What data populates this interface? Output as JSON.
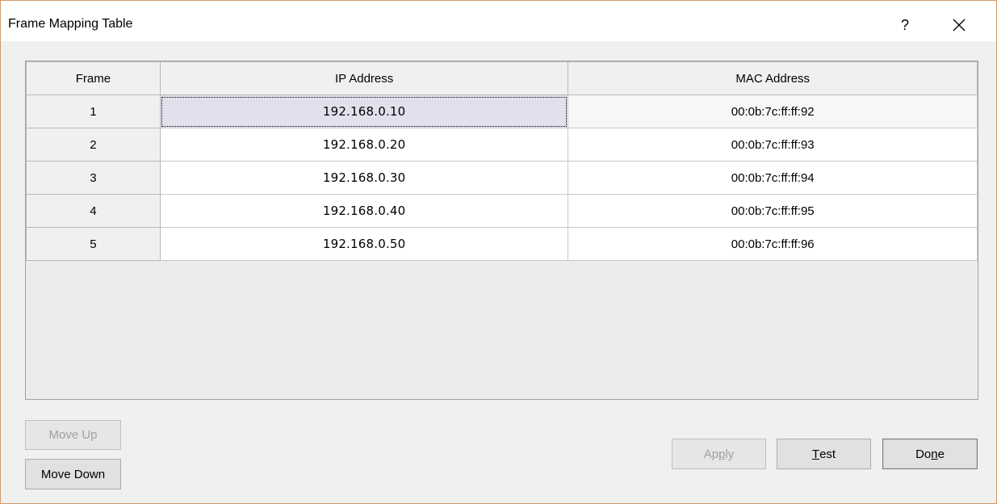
{
  "window": {
    "title": "Frame Mapping Table",
    "help_label": "?",
    "close_icon": "close-icon"
  },
  "table": {
    "columns": [
      "Frame",
      "IP Address",
      "MAC Address"
    ],
    "rows": [
      {
        "frame": "1",
        "ip": "192.168.0.10",
        "mac": "00:0b:7c:ff:ff:92"
      },
      {
        "frame": "2",
        "ip": "192.168.0.20",
        "mac": "00:0b:7c:ff:ff:93"
      },
      {
        "frame": "3",
        "ip": "192.168.0.30",
        "mac": "00:0b:7c:ff:ff:94"
      },
      {
        "frame": "4",
        "ip": "192.168.0.40",
        "mac": "00:0b:7c:ff:ff:95"
      },
      {
        "frame": "5",
        "ip": "192.168.0.50",
        "mac": "00:0b:7c:ff:ff:96"
      }
    ],
    "selected_cell": "1 / IP Address"
  },
  "buttons": {
    "move_up": "Move Up",
    "move_down": "Move Down",
    "apply_pre": "Ap",
    "apply_mn": "p",
    "apply_post": "ly",
    "test_pre": "",
    "test_mn": "T",
    "test_post": "est",
    "done_pre": "Do",
    "done_mn": "n",
    "done_post": "e"
  },
  "colors": {
    "selection": "#e1e1ee",
    "frame_border": "#d09a6a",
    "disabled_text": "#a0a0a0"
  }
}
